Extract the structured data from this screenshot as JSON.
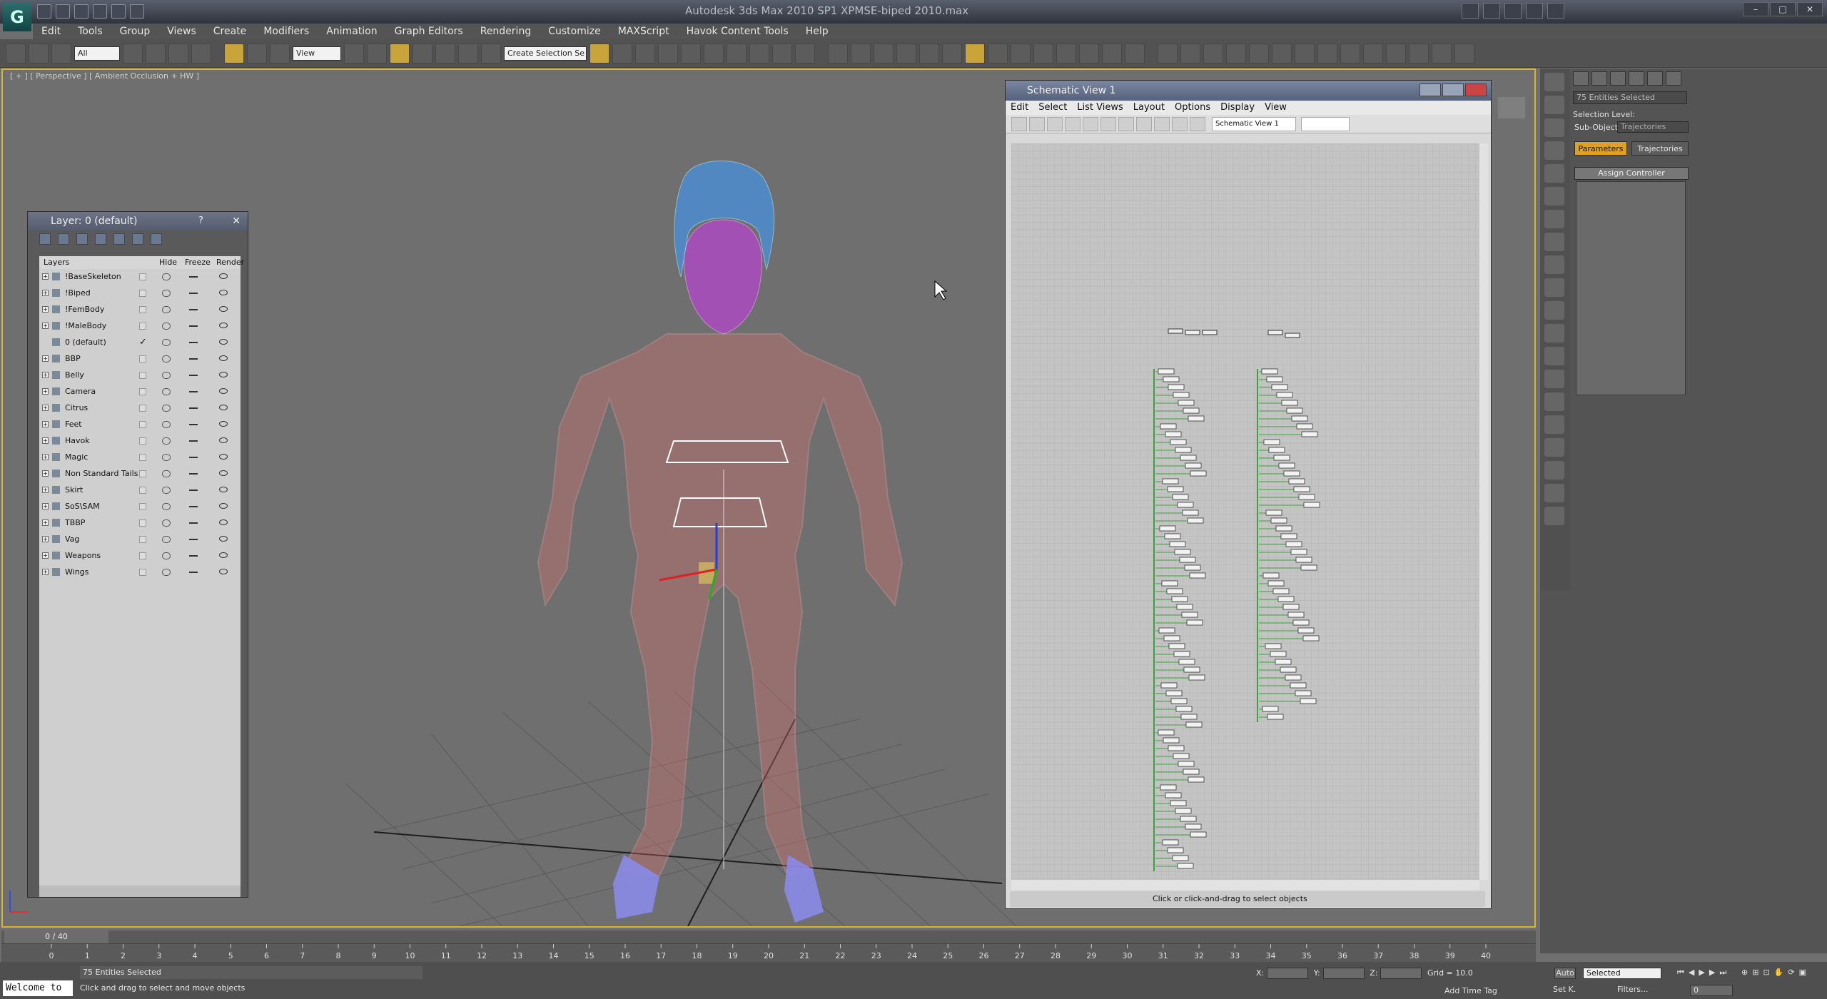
{
  "app": {
    "title": "Autodesk 3ds Max  2010 SP1      XPMSE-biped 2010.max",
    "logo": "3ds Max logo",
    "minimize": "–",
    "maximize": "□",
    "close": "✕"
  },
  "menu": [
    "Edit",
    "Tools",
    "Group",
    "Views",
    "Create",
    "Modifiers",
    "Animation",
    "Graph Editors",
    "Rendering",
    "Customize",
    "MAXScript",
    "Havok Content Tools",
    "Help"
  ],
  "toolbar": {
    "selection_filter": "All",
    "ref_coord": "View",
    "named_selection": "Create Selection Se"
  },
  "viewport": {
    "label": "[ + ] [ Perspective ] [ Ambient Occlusion + HW ]"
  },
  "layer_manager": {
    "title": "Layer: 0 (default)",
    "help": "?",
    "close": "✕",
    "columns": {
      "layers": "Layers",
      "hide": "Hide",
      "freeze": "Freeze",
      "render": "Render"
    },
    "rows": [
      {
        "name": "!BaseSkeleton",
        "current": false
      },
      {
        "name": "!Biped",
        "current": false
      },
      {
        "name": "!FemBody",
        "current": false
      },
      {
        "name": "!MaleBody",
        "current": false
      },
      {
        "name": "0 (default)",
        "current": true
      },
      {
        "name": "BBP",
        "current": false
      },
      {
        "name": "Belly",
        "current": false
      },
      {
        "name": "Camera",
        "current": false
      },
      {
        "name": "Citrus",
        "current": false
      },
      {
        "name": "Feet",
        "current": false
      },
      {
        "name": "Havok",
        "current": false
      },
      {
        "name": "Magic",
        "current": false
      },
      {
        "name": "Non Standard Tails",
        "current": false
      },
      {
        "name": "Skirt",
        "current": false
      },
      {
        "name": "SoS\\SAM",
        "current": false
      },
      {
        "name": "TBBP",
        "current": false
      },
      {
        "name": "Vag",
        "current": false
      },
      {
        "name": "Weapons",
        "current": false
      },
      {
        "name": "Wings",
        "current": false
      }
    ],
    "current_mark": "✓"
  },
  "schematic": {
    "title": "Schematic View 1",
    "menu": [
      "Edit",
      "Select",
      "List Views",
      "Layout",
      "Options",
      "Display",
      "View"
    ],
    "view_name": "Schematic View 1",
    "status": "Click or click-and-drag to select objects"
  },
  "command_panel": {
    "selection_field": "75 Entities Selected",
    "selection_level": "Selection Level:",
    "sub_object": "Sub-Object",
    "sub_object_value": "Trajectories",
    "tab_parameters": "Parameters",
    "tab_trajectories": "Trajectories",
    "assign_controller": "Assign Controller"
  },
  "timeline": {
    "frame": "0 / 40",
    "ticks": [
      "0",
      "1",
      "2",
      "3",
      "4",
      "5",
      "6",
      "7",
      "8",
      "9",
      "10",
      "11",
      "12",
      "13",
      "14",
      "15",
      "16",
      "17",
      "18",
      "19",
      "20",
      "21",
      "22",
      "23",
      "24",
      "25",
      "26",
      "27",
      "28",
      "29",
      "30",
      "31",
      "32",
      "33",
      "34",
      "35",
      "36",
      "37",
      "38",
      "39",
      "40"
    ]
  },
  "status": {
    "selected": "75 Entities Selected",
    "prompt": "Click and drag to select and move objects",
    "listener": "Welcome to",
    "x_label": "X:",
    "y_label": "Y:",
    "z_label": "Z:",
    "grid": "Grid = 10.0",
    "add_time_tag": "Add Time Tag",
    "auto_key": "Auto",
    "set_key": "Set K.",
    "key_mode": "Selected",
    "filters": "Filters...",
    "frame_field": "0"
  },
  "colors": {
    "viewport_border": "#d7b62e",
    "wire_body": "#e07070",
    "wire_hair": "#4a8fd6",
    "wire_face": "#b844d0",
    "wire_feet": "#8a8ae8",
    "schematic_green": "#3aa33a",
    "param_tab": "#e0a020"
  }
}
